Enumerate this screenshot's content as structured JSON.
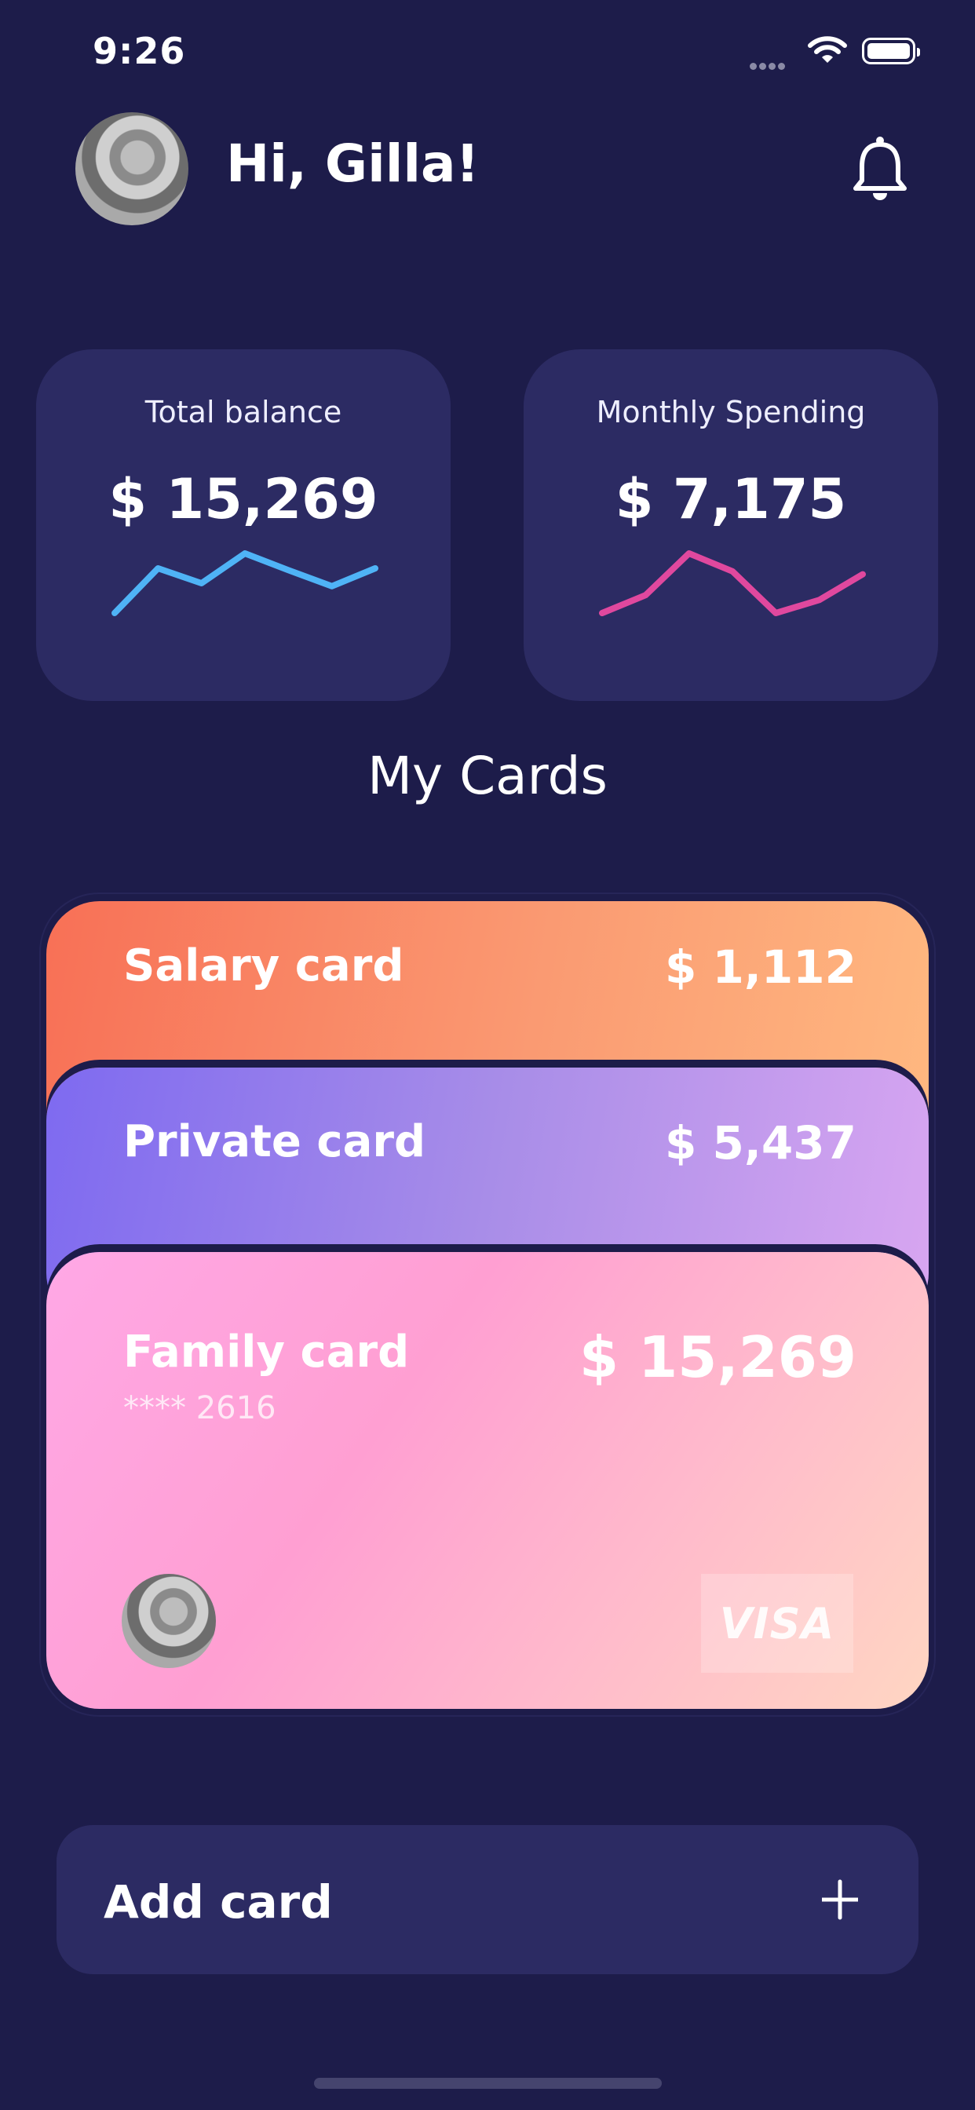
{
  "status_bar": {
    "time": "9:26"
  },
  "header": {
    "greeting": "Hi, Gilla!",
    "avatar_icon": "user-photo-icon",
    "notification_icon": "bell-icon"
  },
  "stats": {
    "total_balance": {
      "label": "Total balance",
      "value": "$ 15,269",
      "sparkline_color": "#4fb3f6",
      "sparkline": [
        0,
        0.75,
        0.5,
        1,
        0.72,
        0.45,
        0.75
      ]
    },
    "monthly_spending": {
      "label": "Monthly Spending",
      "value": "$ 7,175",
      "sparkline_color": "#e0489e",
      "sparkline": [
        0,
        0.3,
        1,
        0.7,
        0,
        0.22,
        0.65
      ]
    }
  },
  "section": {
    "title": "My Cards"
  },
  "cards": [
    {
      "name": "Salary card",
      "amount": "$ 1,112",
      "colors": [
        "#f87056",
        "#ffb880"
      ]
    },
    {
      "name": "Private card",
      "amount": "$ 5,437",
      "colors": [
        "#7e6af0",
        "#d8a6f1"
      ]
    },
    {
      "name": "Family card",
      "amount": "$ 15,269",
      "number": "**** 2616",
      "network": "VISA",
      "colors": [
        "#ffa8e6",
        "#ffd6c2"
      ]
    }
  ],
  "add_card": {
    "label": "Add card",
    "icon": "plus-icon"
  },
  "colors": {
    "background": "#1d1c4a",
    "panel": "#2c2b63"
  }
}
